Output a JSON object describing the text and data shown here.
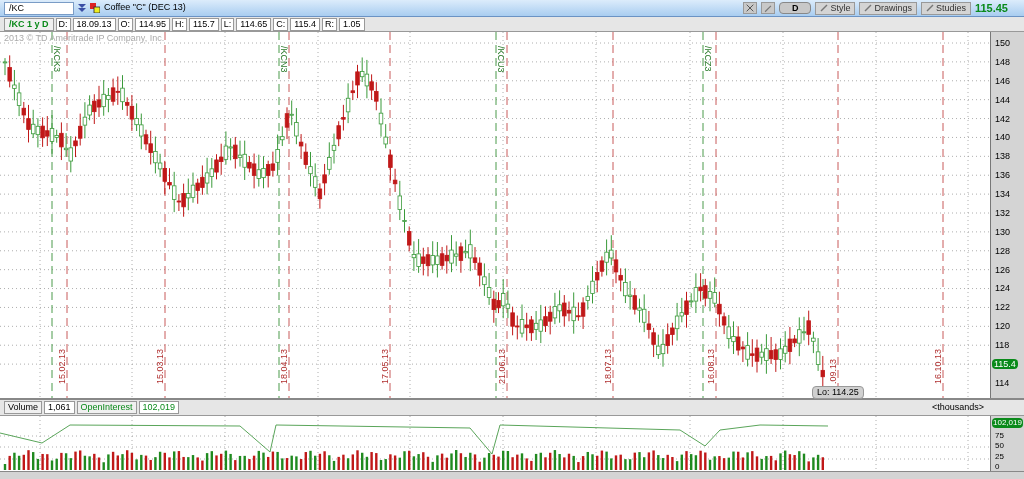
{
  "toolbar": {
    "symbol": "/KC",
    "description": "Coffee \"C\" (DEC 13)",
    "aggregation": "D",
    "buttons": [
      "Style",
      "Drawings",
      "Studies"
    ],
    "last_price": "115.45"
  },
  "info_bar": {
    "chart_label": "/KC 1 y D",
    "fields": [
      {
        "label": "D:",
        "value": "18.09.13"
      },
      {
        "label": "O:",
        "value": "114.95"
      },
      {
        "label": "H:",
        "value": "115.7"
      },
      {
        "label": "L:",
        "value": "114.65"
      },
      {
        "label": "C:",
        "value": "115.4"
      },
      {
        "label": "R:",
        "value": "1.05"
      }
    ]
  },
  "price_chart": {
    "copyright": "2013 © TD Ameritrade IP Company, Inc.",
    "y_axis_labels": [
      "150",
      "148",
      "146",
      "144",
      "142",
      "140",
      "138",
      "136",
      "134",
      "132",
      "130",
      "128",
      "126",
      "124",
      "122",
      "120",
      "118",
      "114"
    ],
    "price_tag": "115.4",
    "low_label": "Lo: 114.25",
    "contract_markers": [
      "/KCK3",
      "/KCN3",
      "/KCU3",
      "/KCZ3"
    ],
    "date_markers": [
      "15.02.13",
      "15.03.13",
      "18.04.13",
      "17.05.13",
      "21.06.13",
      "18.07.13",
      "16.08.13",
      ".09.13",
      "16.10.13"
    ]
  },
  "volume_panel": {
    "studies": [
      {
        "label": "Volume",
        "value": "1,061",
        "kind": "plain"
      },
      {
        "label": "OpenInterest",
        "value": "102,019",
        "kind": "green"
      }
    ],
    "units": "<thousands>",
    "y_axis_labels": [
      "75",
      "50",
      "25",
      "0"
    ],
    "value_tag": "102,019"
  }
}
